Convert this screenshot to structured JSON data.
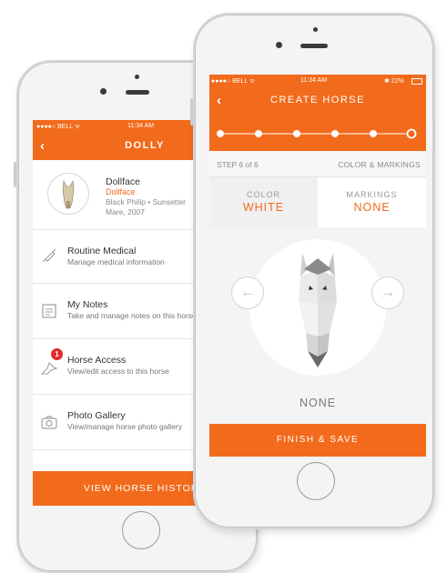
{
  "left_phone": {
    "status": {
      "carrier": "●●●●○ BELL ᯤ",
      "time": "11:34 AM"
    },
    "nav": {
      "title": "DOLLY",
      "back_icon": "chevron-left-icon"
    },
    "profile": {
      "name": "Dollface",
      "subname": "Dollface",
      "details1": "Black Philip • Sunsetter",
      "details2": "Mare, 2007"
    },
    "menu": [
      {
        "title": "Routine Medical",
        "subtitle": "Manage medical information",
        "icon": "syringe-icon"
      },
      {
        "title": "My Notes",
        "subtitle": "Take and manage notes on this horse",
        "icon": "notes-icon"
      },
      {
        "title": "Horse Access",
        "subtitle": "View/edit access to this horse",
        "icon": "horse-access-icon",
        "badge": "1"
      },
      {
        "title": "Photo Gallery",
        "subtitle": "View/manage horse photo gallery",
        "icon": "camera-icon"
      }
    ],
    "footer_button": "VIEW HORSE HISTORY"
  },
  "right_phone": {
    "status": {
      "carrier": "●●●●○ BELL ᯤ",
      "time": "11:34 AM",
      "battery": "✱ 22%"
    },
    "nav": {
      "title": "CREATE HORSE",
      "back_icon": "chevron-left-icon"
    },
    "progress": {
      "current_step": 6,
      "total_steps": 6
    },
    "step_label": "STEP 6 of 6",
    "section_label": "COLOR & MARKINGS",
    "tabs": [
      {
        "label": "COLOR",
        "value": "WHITE"
      },
      {
        "label": "MARKINGS",
        "value": "NONE"
      }
    ],
    "selection_name": "NONE",
    "prev_arrow": "←",
    "next_arrow": "→",
    "finish_button": "FINISH & SAVE"
  },
  "colors": {
    "accent": "#f26a1b",
    "background": "#ffffff",
    "tab_inactive": "#f0f0f0"
  }
}
